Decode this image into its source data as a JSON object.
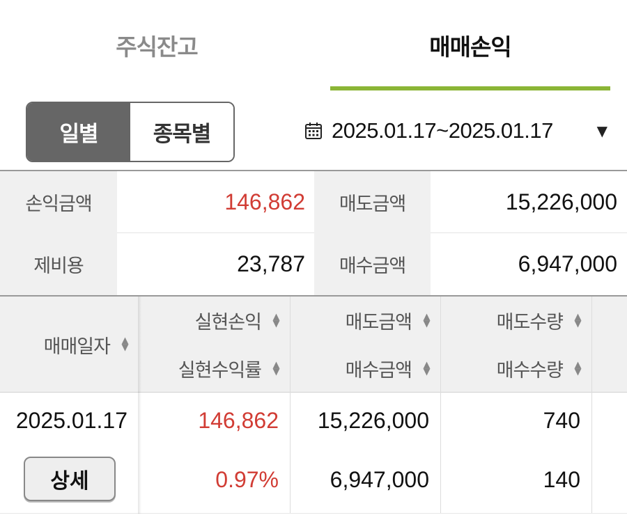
{
  "tabs": {
    "stock_balance": "주식잔고",
    "trade_pnl": "매매손익"
  },
  "toggle": {
    "daily": "일별",
    "by_stock": "종목별"
  },
  "date_filter": {
    "range": "2025.01.17~2025.01.17",
    "icon": "calendar-icon",
    "dropdown_icon": "caret-down-icon"
  },
  "summary": {
    "pnl_label": "손익금액",
    "pnl_value": "146,862",
    "sell_amount_label": "매도금액",
    "sell_amount_value": "15,226,000",
    "fees_label": "제비용",
    "fees_value": "23,787",
    "buy_amount_label": "매수금액",
    "buy_amount_value": "6,947,000"
  },
  "table": {
    "headers": {
      "trade_date": "매매일자",
      "realized_pnl": "실현손익",
      "realized_return": "실현수익률",
      "sell_amount": "매도금액",
      "buy_amount": "매수금액",
      "sell_qty": "매도수량",
      "buy_qty": "매수수량"
    },
    "rows": [
      {
        "trade_date": "2025.01.17",
        "detail_label": "상세",
        "realized_pnl": "146,862",
        "realized_return": "0.97%",
        "sell_amount": "15,226,000",
        "buy_amount": "6,947,000",
        "sell_qty": "740",
        "buy_qty": "140"
      }
    ]
  },
  "colors": {
    "accent_underline": "#8bb536",
    "profit_red": "#d13c34",
    "toggle_active_bg": "#666666"
  }
}
